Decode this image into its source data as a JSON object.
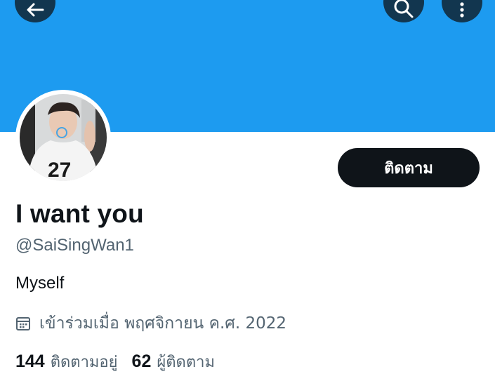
{
  "header": {
    "back_icon": "arrow-left-icon",
    "search_icon": "search-icon",
    "more_icon": "more-vertical-icon",
    "banner_color": "#1d9bf0"
  },
  "profile": {
    "display_name": "I want you",
    "handle": "@SaiSingWan1",
    "bio": "Myself",
    "joined": "เข้าร่วมเมื่อ พฤศจิกายน ค.ศ. 2022",
    "joined_icon": "calendar-icon",
    "follow_button_label": "ติดตาม"
  },
  "stats": {
    "following_count": "144",
    "following_label": "ติดตามอยู่",
    "followers_count": "62",
    "followers_label": "ผู้ติดตาม"
  },
  "colors": {
    "primary_text": "#0f1419",
    "secondary_text": "#536471",
    "follow_button_bg": "#0f1419"
  }
}
